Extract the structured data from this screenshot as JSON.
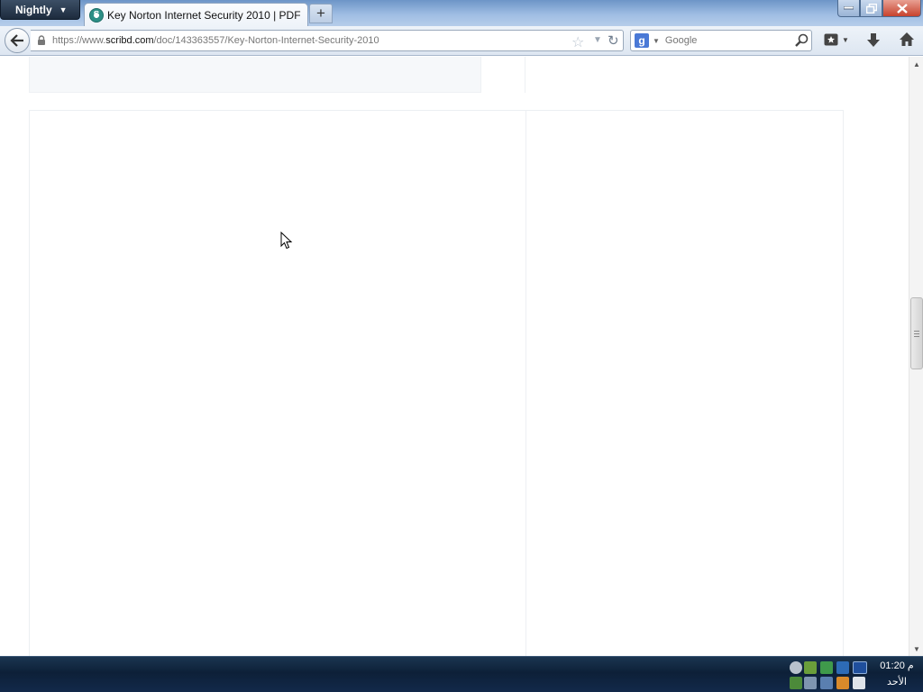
{
  "browser": {
    "app_menu_label": "Nightly",
    "tab": {
      "title": "Key Norton Internet Security 2010 | PDF"
    },
    "new_tab_label": "+",
    "url": {
      "prefix": "https://www.",
      "domain": "scribd.com",
      "path": "/doc/143363557/Key-Norton-Internet-Security-2010"
    },
    "search": {
      "engine": "Google",
      "placeholder": "Google"
    }
  },
  "taskbar": {
    "clock_time": "01:20 م",
    "clock_label": "الأحد"
  },
  "colors": {
    "titlebar": "#9fbde3",
    "app_menu": "#2a3a4f",
    "taskbar": "#0d2038",
    "close_button": "#c7422d"
  },
  "icons": [
    "back-arrow-icon",
    "lock-icon",
    "bookmark-star-icon",
    "reload-icon",
    "google-icon",
    "search-magnifier-icon",
    "bookmarks-menu-icon",
    "download-arrow-icon",
    "home-icon",
    "minimize-icon",
    "restore-icon",
    "close-icon"
  ]
}
